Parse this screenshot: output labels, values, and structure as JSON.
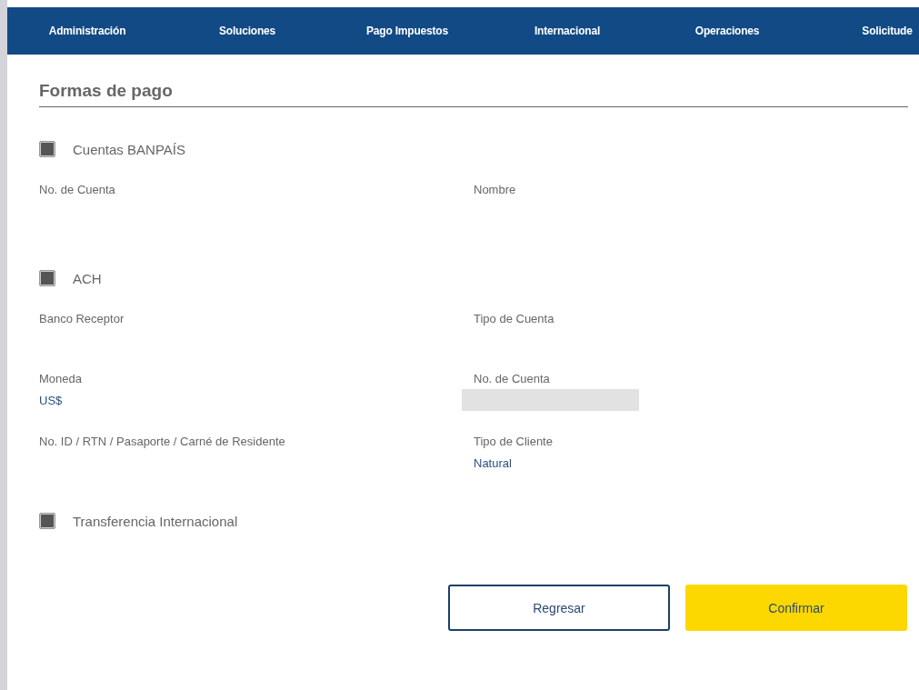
{
  "nav": {
    "items": [
      {
        "label": "Administración"
      },
      {
        "label": "Soluciones"
      },
      {
        "label": "Pago Impuestos"
      },
      {
        "label": "Internacional"
      },
      {
        "label": "Operaciones"
      },
      {
        "label": "Solicitude"
      }
    ]
  },
  "title": "Formas de pago",
  "sections": [
    {
      "label": "Cuentas BANPAÍS",
      "checked": true,
      "rows": [
        [
          {
            "label": "No. de Cuenta",
            "kind": "text"
          },
          {
            "label": "Nombre",
            "kind": "text"
          }
        ]
      ]
    },
    {
      "label": "ACH",
      "checked": true,
      "rows": [
        [
          {
            "label": "Banco Receptor",
            "kind": "text"
          },
          {
            "label": "Tipo de Cuenta",
            "kind": "text"
          }
        ],
        [
          {
            "label": "Moneda",
            "kind": "text",
            "value": "US$"
          },
          {
            "label": "No. de Cuenta",
            "kind": "input"
          }
        ],
        [
          {
            "label": "No. ID / RTN / Pasaporte / Carné de Residente",
            "kind": "text"
          },
          {
            "label": "Tipo de Cliente",
            "kind": "text",
            "value": "Natural"
          }
        ]
      ]
    },
    {
      "label": "Transferencia Internacional",
      "checked": true
    }
  ],
  "buttons": [
    {
      "label": "Regresar",
      "kind": "secondary"
    },
    {
      "label": "Confirmar",
      "kind": "primary"
    }
  ]
}
